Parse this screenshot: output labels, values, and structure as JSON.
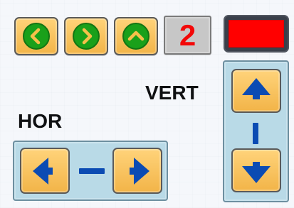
{
  "toolbar": {
    "back": {
      "icon": "chevron-left-icon"
    },
    "forward": {
      "icon": "chevron-right-icon"
    },
    "up": {
      "icon": "chevron-up-icon"
    },
    "counter": "2",
    "stop": {
      "color": "#ff0000"
    }
  },
  "labels": {
    "horizontal": "HOR",
    "vertical": "VERT"
  },
  "colors": {
    "accent_yellow": "#f2b448",
    "accent_green": "#1aa01a",
    "accent_blue": "#0b4bb3",
    "panel_blue": "#b9dae7",
    "counter_red": "#f30808"
  },
  "controls": {
    "horizontal": {
      "left_icon": "arrow-left-icon",
      "right_icon": "arrow-right-icon"
    },
    "vertical": {
      "up_icon": "arrow-up-icon",
      "down_icon": "arrow-down-icon"
    }
  }
}
